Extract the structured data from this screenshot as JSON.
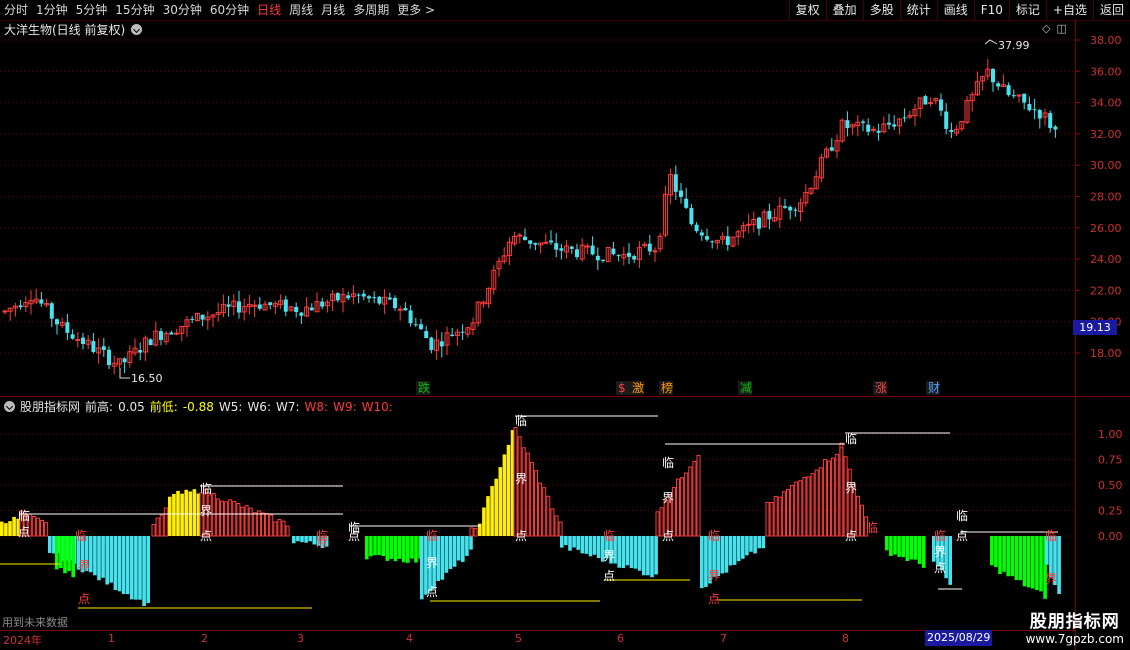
{
  "toolbar": {
    "periods": [
      "分时",
      "1分钟",
      "5分钟",
      "15分钟",
      "30分钟",
      "60分钟",
      "日线",
      "周线",
      "月线",
      "多周期",
      "更多 >"
    ],
    "active_period": "日线",
    "actions": [
      "复权",
      "叠加",
      "多股",
      "统计",
      "画线",
      "F10",
      "标记",
      "+自选",
      "返回"
    ]
  },
  "stock_title": "大洋生物(日线 前复权)",
  "indicator": {
    "name": "股朋指标网",
    "high_label": "前高:",
    "high_value": "0.05",
    "low_label": "前低:",
    "low_value": "-0.88",
    "w_labels": [
      "W5:",
      "W6:",
      "W7:"
    ],
    "w_red_labels": [
      "W8:",
      "W9:",
      "W10:"
    ]
  },
  "future_note": "用到未来数据",
  "price_axis": [
    "38.00",
    "36.00",
    "34.00",
    "32.00",
    "30.00",
    "28.00",
    "26.00",
    "24.00",
    "22.00",
    "20.00",
    "18.00"
  ],
  "current_price": "19.13",
  "max_label": "37.99",
  "min_label": "16.50",
  "indicator_axis": [
    "1.00",
    "0.75",
    "0.50",
    "0.25",
    "0.00"
  ],
  "date_axis": [
    "2024年",
    "1",
    "2",
    "3",
    "4",
    "5",
    "6",
    "7",
    "8"
  ],
  "selected_date": "2025/08/29",
  "event_markers": [
    {
      "text": "跌",
      "color": "#00c000"
    },
    {
      "text": "$",
      "color": "#ff4040"
    },
    {
      "text": "激",
      "color": "#ff9900"
    },
    {
      "text": "榜",
      "color": "#ff9900"
    },
    {
      "text": "减",
      "color": "#00c000"
    },
    {
      "text": "涨",
      "color": "#ff4040"
    },
    {
      "text": "财",
      "color": "#4fa3ff"
    }
  ],
  "signal_labels": {
    "lin": "临",
    "jie": "界",
    "dian": "点"
  },
  "watermark": {
    "title": "股朋指标网",
    "url": "www.7gpzb.com"
  },
  "colors": {
    "up": "#ff3b3b",
    "down": "#46e3ee",
    "yellow": "#ffee00",
    "green": "#00ff00",
    "grid": "#6a0000"
  }
}
